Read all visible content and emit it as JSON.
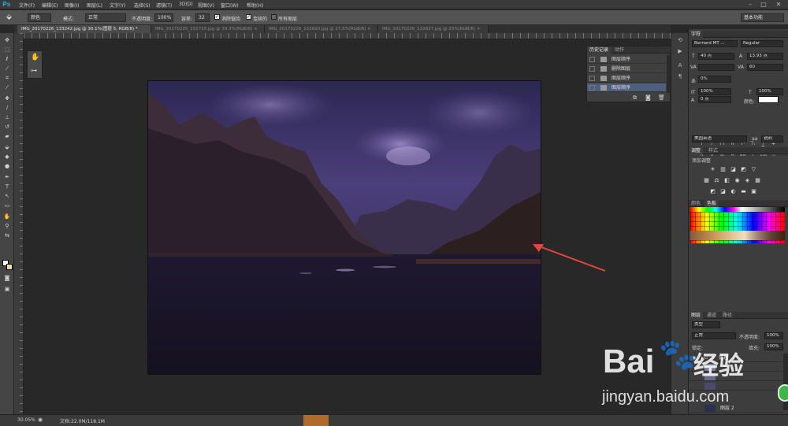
{
  "app": {
    "logo": "Ps"
  },
  "menu": [
    "文件(F)",
    "编辑(E)",
    "图像(I)",
    "图层(L)",
    "文字(Y)",
    "选择(S)",
    "滤镜(T)",
    "3D(D)",
    "视图(V)",
    "窗口(W)",
    "帮助(H)"
  ],
  "window_controls": [
    "–",
    "□",
    "✕"
  ],
  "options": {
    "brush_mode": "颜色",
    "mode_label": "模式:",
    "mode_value": "正常",
    "opacity_label": "不透明度:",
    "opacity_value": "100%",
    "tolerance_label": "容差:",
    "tolerance_value": "32",
    "antialias": "消除锯齿",
    "contiguous": "连续的",
    "all_layers": "所有图层",
    "workspace": "基本功能"
  },
  "tabs": [
    {
      "label": "IMG_20170226_133242.jpg @ 30.1%(图层 5, RGB/8) *",
      "active": true
    },
    {
      "label": "IMG_20170225_151715.jpg @ 33.3%(RGB/8) ×",
      "active": false
    },
    {
      "label": "IMG_20170226_122820.jpg @ 27.5%(RGB/8) ×",
      "active": false
    },
    {
      "label": "IMG_20170226_122827.jpg @ 25%(RGB/8) ×",
      "active": false
    }
  ],
  "status": {
    "zoom": "30.05%",
    "doc": "文档:22.0M/118.1M"
  },
  "history": {
    "tabs": [
      "历史记录",
      "动作"
    ],
    "items": [
      "图层顺序",
      "删除图层",
      "图层顺序",
      "图层顺序"
    ],
    "selected_index": 3
  },
  "character": {
    "tab": "字符",
    "font_family": "Bernard MT ...",
    "font_style": "Regular",
    "size": "40 点",
    "leading": "13.93 点",
    "kerning": "",
    "tracking": "60",
    "shift": "0%",
    "vscale": "100%",
    "hscale": "100%",
    "baseline": "0 点",
    "color_label": "颜色:",
    "styles": [
      "T",
      "T",
      "TT",
      "Tr",
      "T¹",
      "T₁",
      "T",
      "T"
    ],
    "opentype": [
      "fi",
      "σ",
      "st",
      "A",
      "aa",
      "T",
      "1st",
      "½"
    ],
    "language": "美国英语",
    "antialias": "锐利",
    "aa_prefix": "aa"
  },
  "adjustments": {
    "tabs": [
      "调整",
      "样式"
    ],
    "title": "添加调整"
  },
  "swatches": {
    "tabs": [
      "颜色",
      "色板"
    ]
  },
  "layers": {
    "tabs": [
      "图层",
      "通道",
      "路径"
    ],
    "kind": "类型",
    "blend": "正常",
    "opacity_label": "不透明度:",
    "opacity": "100%",
    "lock_label": "锁定:",
    "fill_label": "填充:",
    "fill": "100%",
    "items": [
      {
        "name": "处理",
        "type": "group"
      },
      {
        "name": "",
        "type": "layer"
      },
      {
        "name": "",
        "type": "layer"
      },
      {
        "name": "",
        "type": "layer"
      },
      {
        "name": "图层 2",
        "type": "layer"
      }
    ]
  },
  "watermark": {
    "brand": "Bai",
    "brand_cn": "经验",
    "url": "jingyan.baidu.com"
  },
  "colors": {
    "selection": "#4e5f7d",
    "accent": "#e0483e",
    "badge": "#3fb44a"
  }
}
